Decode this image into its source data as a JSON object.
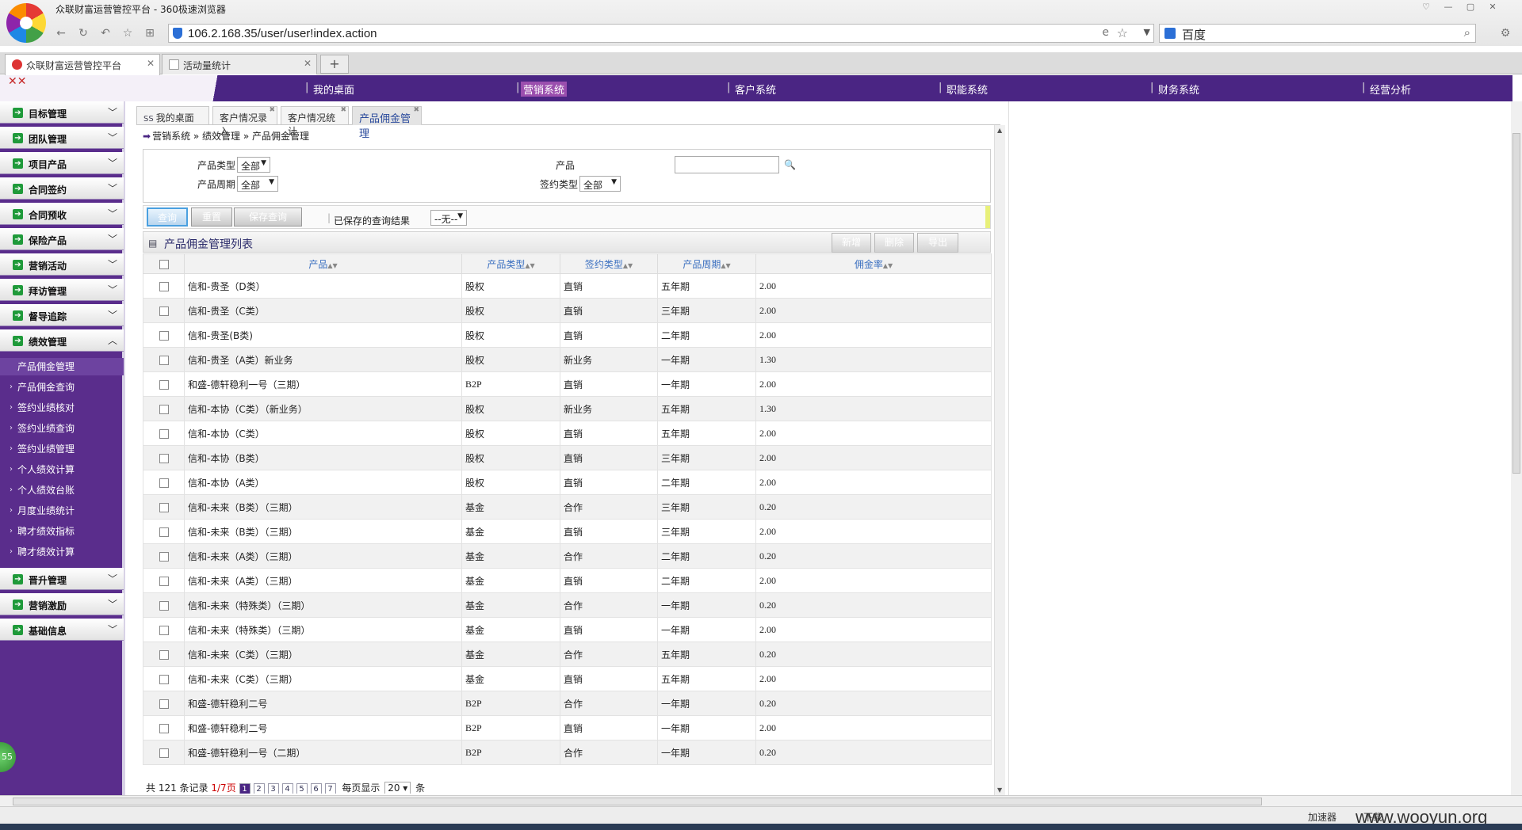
{
  "browser": {
    "window_title": "众联财富运营管控平台 - 360极速浏览器",
    "url": "106.2.168.35/user/user!index.action",
    "search_engine": "百度",
    "tabs": [
      {
        "label": "众联财富运营管控平台",
        "active": true
      },
      {
        "label": "活动量统计",
        "active": false
      }
    ],
    "status_accel": "加速器",
    "status_download": "下载",
    "watermark": "www.wooyun.org"
  },
  "topnav": {
    "items": [
      "我的桌面",
      "营销系统",
      "客户系统",
      "职能系统",
      "财务系统",
      "经营分析"
    ],
    "active": "营销系统"
  },
  "sidebar": {
    "menu_top": [
      "目标管理",
      "团队管理",
      "项目产品",
      "合同签约",
      "合同预收",
      "保险产品",
      "营销活动",
      "拜访管理",
      "督导追踪",
      "绩效管理"
    ],
    "submenu": [
      "产品佣金管理",
      "产品佣金查询",
      "签约业绩核对",
      "签约业绩查询",
      "签约业绩管理",
      "个人绩效计算",
      "个人绩效台账",
      "月度业绩统计",
      "聘才绩效指标",
      "聘才绩效计算"
    ],
    "submenu_active": "产品佣金管理",
    "menu_bottom": [
      "晋升管理",
      "营销激励",
      "基础信息"
    ],
    "badge": "55"
  },
  "content_tabs": [
    "我的桌面",
    "客户情况录入",
    "客户情况统计",
    "产品佣金管理"
  ],
  "breadcrumb": "营销系统 » 绩效管理 » 产品佣金管理",
  "filter": {
    "product_type_label": "产品类型",
    "product_type_value": "全部",
    "product_period_label": "产品周期",
    "product_period_value": "全部",
    "product_label": "产品",
    "product_value": "",
    "sign_type_label": "签约类型",
    "sign_type_value": "全部"
  },
  "buttons": {
    "query": "查询",
    "reset": "重置",
    "save_query": "保存查询",
    "saved_label": "已保存的查询结果",
    "saved_value": "--无--"
  },
  "list": {
    "title": "产品佣金管理列表",
    "add": "新增",
    "delete": "删除",
    "export": "导出",
    "columns": [
      "产品",
      "产品类型",
      "签约类型",
      "产品周期",
      "佣金率"
    ],
    "rows": [
      [
        "信和-贵圣（D类）",
        "股权",
        "直销",
        "五年期",
        "2.00"
      ],
      [
        "信和-贵圣（C类）",
        "股权",
        "直销",
        "三年期",
        "2.00"
      ],
      [
        "信和-贵圣(B类)",
        "股权",
        "直销",
        "二年期",
        "2.00"
      ],
      [
        "信和-贵圣（A类）新业务",
        "股权",
        "新业务",
        "一年期",
        "1.30"
      ],
      [
        "和盛-德轩稳利一号（三期）",
        "B2P",
        "直销",
        "一年期",
        "2.00"
      ],
      [
        "信和-本协（C类）（新业务）",
        "股权",
        "新业务",
        "五年期",
        "1.30"
      ],
      [
        "信和-本协（C类）",
        "股权",
        "直销",
        "五年期",
        "2.00"
      ],
      [
        "信和-本协（B类）",
        "股权",
        "直销",
        "三年期",
        "2.00"
      ],
      [
        "信和-本协（A类）",
        "股权",
        "直销",
        "二年期",
        "2.00"
      ],
      [
        "信和-未来（B类）（三期）",
        "基金",
        "合作",
        "三年期",
        "0.20"
      ],
      [
        "信和-未来（B类）（三期）",
        "基金",
        "直销",
        "三年期",
        "2.00"
      ],
      [
        "信和-未来（A类）（三期）",
        "基金",
        "合作",
        "二年期",
        "0.20"
      ],
      [
        "信和-未来（A类）（三期）",
        "基金",
        "直销",
        "二年期",
        "2.00"
      ],
      [
        "信和-未来（特殊类）（三期）",
        "基金",
        "合作",
        "一年期",
        "0.20"
      ],
      [
        "信和-未来（特殊类）（三期）",
        "基金",
        "直销",
        "一年期",
        "2.00"
      ],
      [
        "信和-未来（C类）（三期）",
        "基金",
        "合作",
        "五年期",
        "0.20"
      ],
      [
        "信和-未来（C类）（三期）",
        "基金",
        "直销",
        "五年期",
        "2.00"
      ],
      [
        "和盛-德轩稳利二号",
        "B2P",
        "合作",
        "一年期",
        "0.20"
      ],
      [
        "和盛-德轩稳利二号",
        "B2P",
        "直销",
        "一年期",
        "2.00"
      ],
      [
        "和盛-德轩稳利一号（二期）",
        "B2P",
        "合作",
        "一年期",
        "0.20"
      ]
    ]
  },
  "pager": {
    "total_text": "共 121 条记录",
    "page_text": "1/7页",
    "pages": [
      "1",
      "2",
      "3",
      "4",
      "5",
      "6",
      "7"
    ],
    "per_page_label": "每页显示",
    "per_page_value": "20",
    "unit": "条"
  },
  "colors": {
    "nav_purple": "#4a2583",
    "sidebar_purple": "#5a2d8c",
    "active_nav": "#9b4fae",
    "menu_icon_green": "#1f9a3a"
  }
}
